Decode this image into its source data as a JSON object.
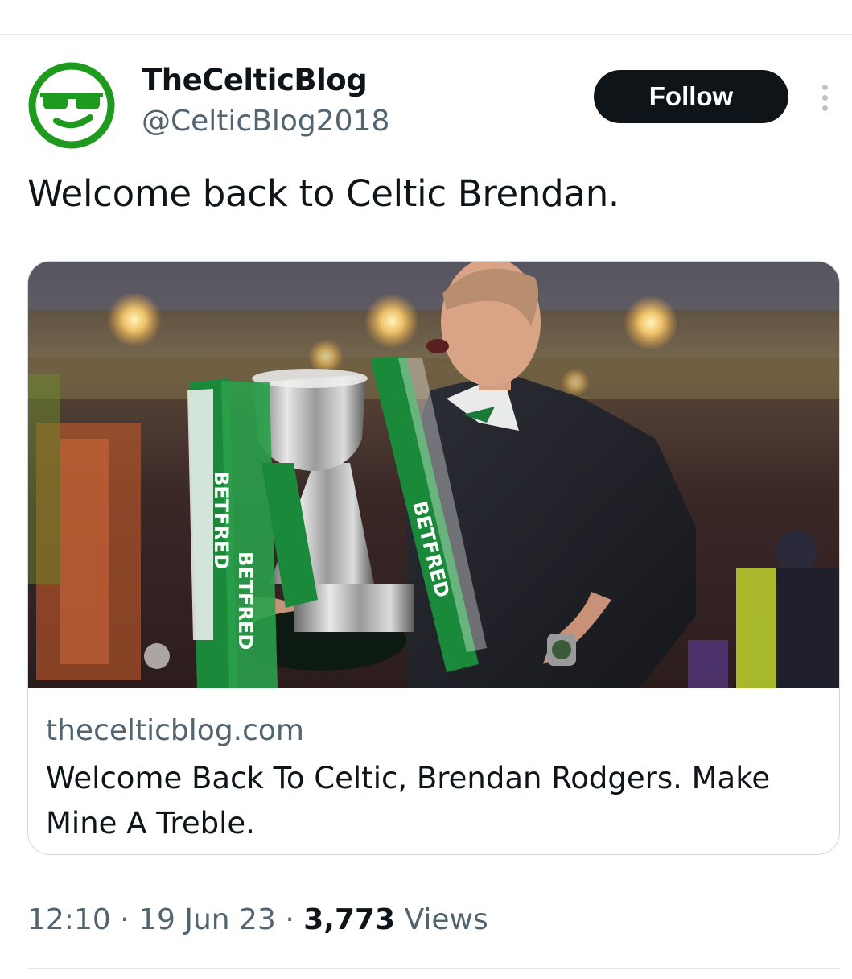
{
  "author": {
    "name": "TheCelticBlog",
    "handle": "@CelticBlog2018",
    "avatar_icon": "sunglasses-smiley-icon",
    "avatar_color": "#1e9b1e"
  },
  "actions": {
    "follow_label": "Follow",
    "more_icon": "more-vertical-icon"
  },
  "tweet": {
    "text": "Welcome back to Celtic Brendan."
  },
  "link_card": {
    "domain": "thecelticblog.com",
    "title": "Welcome Back To Celtic, Brendan Rodgers. Make Mine A Treble.",
    "image_ribbon_text": "BETFRED"
  },
  "meta": {
    "time": "12:10",
    "separator": "·",
    "date": "19 Jun 23",
    "views_count": "3,773",
    "views_label": "Views"
  },
  "colors": {
    "text_primary": "#0f1419",
    "text_secondary": "#536471",
    "border": "#cfd9de",
    "follow_bg": "#0f1419",
    "ribbon_green": "#1a8a3a"
  }
}
